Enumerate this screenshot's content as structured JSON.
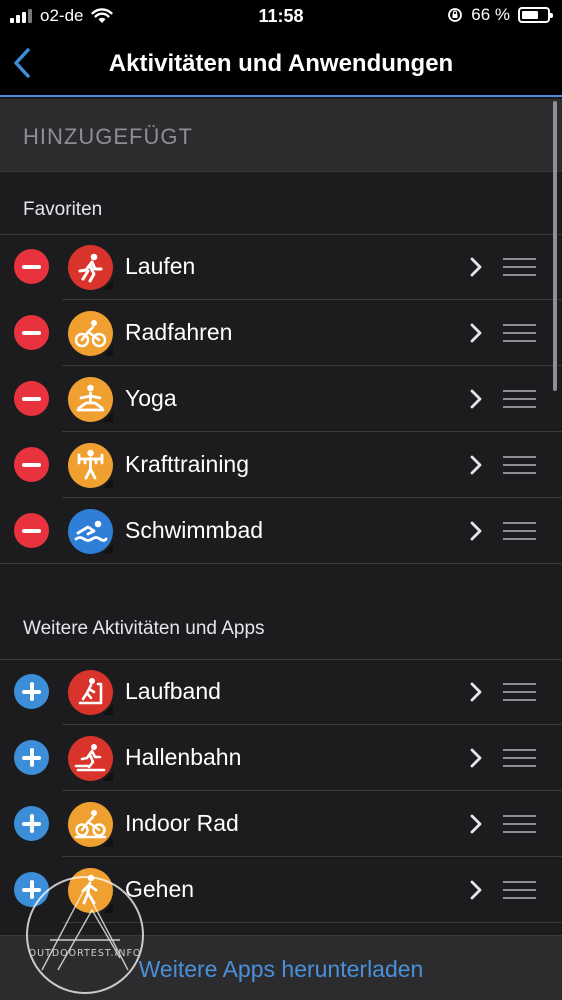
{
  "status_bar": {
    "carrier": "o2-de",
    "time": "11:58",
    "battery_percent": "66 %",
    "battery_level": 0.66
  },
  "nav": {
    "title": "Aktivitäten und Anwendungen"
  },
  "section_header": "HINZUGEFÜGT",
  "favorites": {
    "label": "Favoriten",
    "items": [
      {
        "label": "Laufen",
        "icon": "running-icon",
        "color": "#d8342c"
      },
      {
        "label": "Radfahren",
        "icon": "cycling-icon",
        "color": "#f0a030"
      },
      {
        "label": "Yoga",
        "icon": "yoga-icon",
        "color": "#f0a030"
      },
      {
        "label": "Krafttraining",
        "icon": "strength-training-icon",
        "color": "#f0a030"
      },
      {
        "label": "Schwimmbad",
        "icon": "pool-swim-icon",
        "color": "#2f7fd8"
      }
    ]
  },
  "more": {
    "label": "Weitere Aktivitäten und Apps",
    "items": [
      {
        "label": "Laufband",
        "icon": "treadmill-icon",
        "color": "#d8342c"
      },
      {
        "label": "Hallenbahn",
        "icon": "indoor-track-icon",
        "color": "#d8342c"
      },
      {
        "label": "Indoor Rad",
        "icon": "indoor-bike-icon",
        "color": "#f0a030"
      },
      {
        "label": "Gehen",
        "icon": "walking-icon",
        "color": "#f0a030"
      }
    ]
  },
  "bottom": {
    "link": "Weitere Apps herunterladen"
  },
  "watermark": {
    "text": "OUTDOORTEST.INFO"
  }
}
